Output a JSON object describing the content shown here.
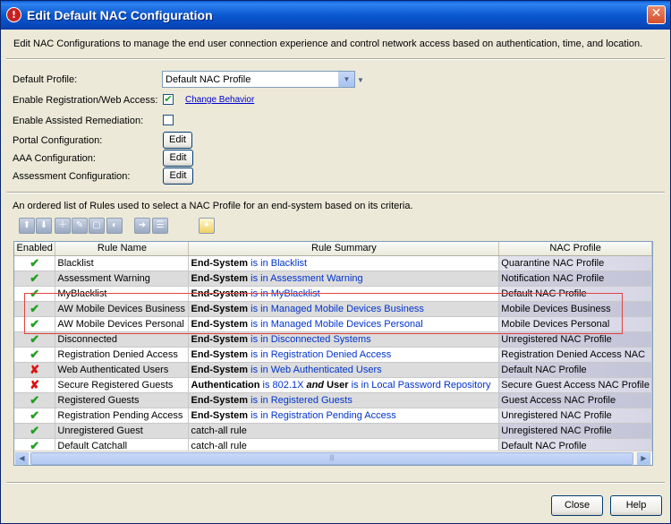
{
  "window": {
    "title": "Edit Default NAC Configuration",
    "close_glyph": "✕"
  },
  "intro": "Edit NAC Configurations to manage the end user connection experience and control network access based on authentication, time, and location.",
  "form": {
    "default_profile_label": "Default Profile:",
    "default_profile_value": "Default NAC Profile",
    "enable_registration_label": "Enable Registration/Web Access:",
    "enable_registration_checked": true,
    "change_behavior_link": "Change Behavior",
    "enable_assisted_label": "Enable Assisted Remediation:",
    "enable_assisted_checked": false,
    "portal_label": "Portal Configuration:",
    "aaa_label": "AAA Configuration:",
    "assessment_label": "Assessment Configuration:",
    "edit_label": "Edit"
  },
  "rules_description": "An ordered list of Rules used to select a NAC Profile for an end-system based on its criteria.",
  "toolbar": {
    "icons": [
      "move-up-icon",
      "move-down-icon",
      "add-rule-icon",
      "edit-rule-icon",
      "delete-rule-icon",
      "copy-rule-icon",
      "export-icon",
      "import-icon",
      "wizard-icon"
    ]
  },
  "table": {
    "columns": [
      "Enabled",
      "Rule Name",
      "Rule Summary",
      "NAC Profile"
    ],
    "rows": [
      {
        "enabled": true,
        "name": "Blacklist",
        "summary_a": "End-System",
        "summary_b": " is in Blacklist",
        "profile": "Quarantine NAC Profile"
      },
      {
        "enabled": true,
        "name": "Assessment Warning",
        "summary_a": "End-System",
        "summary_b": " is in Assessment Warning",
        "profile": "Notification NAC Profile"
      },
      {
        "enabled": true,
        "name": "MyBlacklist",
        "summary_a": "End-System",
        "summary_b": " is in MyBlacklist",
        "profile": "Default NAC Profile"
      },
      {
        "enabled": true,
        "name": "AW Mobile Devices Business",
        "summary_a": "End-System",
        "summary_b": " is in Managed Mobile Devices Business",
        "profile": "Mobile Devices Business"
      },
      {
        "enabled": true,
        "name": "AW Mobile Devices Personal",
        "summary_a": "End-System",
        "summary_b": " is in Managed Mobile Devices Personal",
        "profile": "Mobile Devices Personal"
      },
      {
        "enabled": true,
        "name": "Disconnected",
        "summary_a": "End-System",
        "summary_b": " is in Disconnected Systems",
        "profile": "Unregistered NAC Profile"
      },
      {
        "enabled": true,
        "name": "Registration Denied Access",
        "summary_a": "End-System",
        "summary_b": " is in Registration Denied Access",
        "profile": "Registration Denied Access NAC"
      },
      {
        "enabled": false,
        "name": "Web Authenticated Users",
        "summary_a": "End-System",
        "summary_b": " is in Web Authenticated Users",
        "profile": "Default NAC Profile"
      },
      {
        "enabled": false,
        "name": "Secure Registered Guests",
        "summary_a": "Authentication",
        "summary_b": " is 802.1X ",
        "summary_c": "and",
        "summary_d": "User",
        "summary_e": " is in Local Password Repository",
        "profile": "Secure Guest Access NAC Profile"
      },
      {
        "enabled": true,
        "name": "Registered Guests",
        "summary_a": "End-System",
        "summary_b": " is in Registered Guests",
        "profile": "Guest Access NAC Profile"
      },
      {
        "enabled": true,
        "name": "Registration Pending Access",
        "summary_a": "End-System",
        "summary_b": " is in Registration Pending Access",
        "profile": "Unregistered NAC Profile"
      },
      {
        "enabled": true,
        "name": "Unregistered Guest",
        "summary_plain": "catch-all rule",
        "profile": "Unregistered NAC Profile"
      },
      {
        "enabled": true,
        "name": "Default Catchall",
        "summary_plain": "catch-all rule",
        "profile": "Default NAC Profile"
      }
    ],
    "scroll_grip": "|||"
  },
  "footer": {
    "close_label": "Close",
    "help_label": "Help"
  },
  "colors": {
    "title_bar": "#0a58d0",
    "check": "#20a020",
    "cross": "#e01010",
    "link_text": "#0033cc",
    "highlight_border": "#e24242"
  }
}
